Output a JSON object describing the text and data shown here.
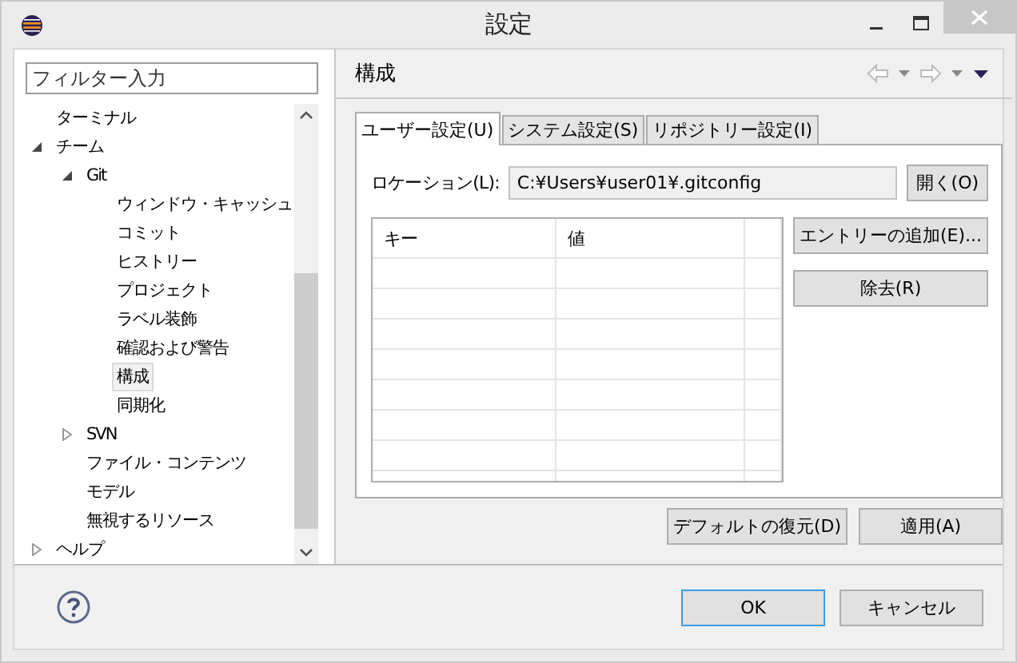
{
  "window": {
    "title": "設定"
  },
  "filter": {
    "placeholder": "フィルター入力"
  },
  "tree": [
    {
      "label": "ターミナル",
      "selected": false
    },
    {
      "label": "チーム",
      "selected": false,
      "expanded": true,
      "children": [
        {
          "label": "Git",
          "selected": false,
          "expanded": true,
          "children": [
            {
              "label": "ウィンドウ・キャッシュ",
              "selected": false
            },
            {
              "label": "コミット",
              "selected": false
            },
            {
              "label": "ヒストリー",
              "selected": false
            },
            {
              "label": "プロジェクト",
              "selected": false
            },
            {
              "label": "ラベル装飾",
              "selected": false
            },
            {
              "label": "確認および警告",
              "selected": false
            },
            {
              "label": "構成",
              "selected": true
            },
            {
              "label": "同期化",
              "selected": false
            }
          ]
        },
        {
          "label": "SVN",
          "selected": false,
          "expanded": false
        },
        {
          "label": "ファイル・コンテンツ",
          "selected": false
        },
        {
          "label": "モデル",
          "selected": false
        },
        {
          "label": "無視するリソース",
          "selected": false
        }
      ]
    },
    {
      "label": "ヘルプ",
      "selected": false,
      "expanded": false
    }
  ],
  "page": {
    "title": "構成"
  },
  "tabs": [
    {
      "label": "ユーザー設定(U)",
      "selected": true
    },
    {
      "label": "システム設定(S)",
      "selected": false
    },
    {
      "label": "リポジトリー設定(I)",
      "selected": false
    }
  ],
  "location": {
    "label": "ロケーション(L):",
    "value": "C:¥Users¥user01¥.gitconfig",
    "button": "開く(O)"
  },
  "table": {
    "columns": [
      "キー",
      "値"
    ]
  },
  "side_buttons": [
    "エントリーの追加(E)...",
    "除去(R)"
  ],
  "page_buttons": [
    "デフォルトの復元(D)",
    "適用(A)"
  ],
  "dialog_buttons": [
    {
      "label": "OK",
      "default": true
    },
    {
      "label": "キャンセル",
      "default": false
    }
  ]
}
